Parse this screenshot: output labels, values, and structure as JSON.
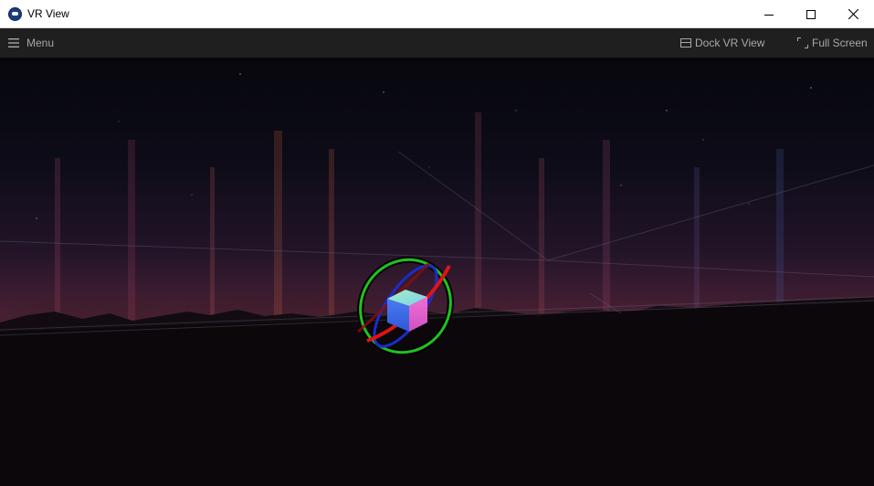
{
  "window": {
    "title": "VR View",
    "icon": "vr-app-icon",
    "controls": [
      "minimize-icon",
      "maximize-icon",
      "close-icon"
    ]
  },
  "toolbar": {
    "menu_label": "Menu",
    "menu_icon": "hamburger-icon",
    "dock_label": "Dock VR View",
    "dock_icon": "dock-icon",
    "fullscreen_label": "Full Screen",
    "fullscreen_icon": "fullscreen-icon"
  },
  "colors": {
    "titlebar": "#ffffff",
    "toolbar": "#1f1f1f",
    "toolbar_text": "#a8a8a8",
    "ring_red": "#e01414",
    "ring_green": "#1fc21f",
    "ring_blue": "#1a2ccc"
  }
}
